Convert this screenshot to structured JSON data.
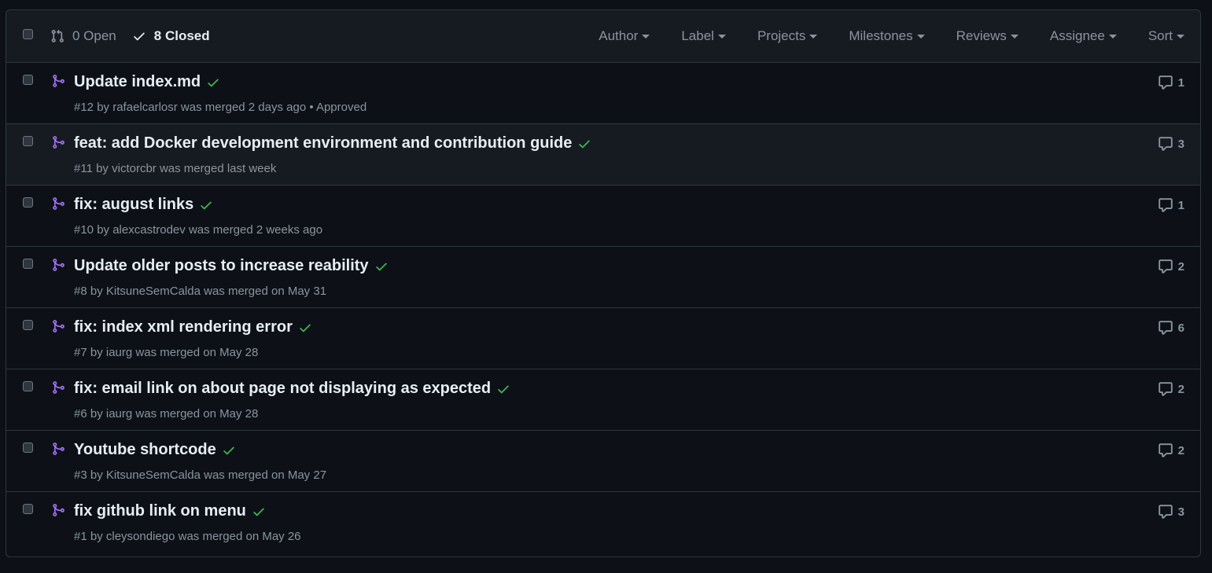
{
  "header": {
    "open_label": "0 Open",
    "closed_label": "8 Closed",
    "filters": [
      "Author",
      "Label",
      "Projects",
      "Milestones",
      "Reviews",
      "Assignee",
      "Sort"
    ]
  },
  "colors": {
    "merged_icon": "#a371f7",
    "check": "#3fb950",
    "text_primary": "#e6edf3",
    "text_muted": "#8b949e"
  },
  "pulls": [
    {
      "title": "Update index.md",
      "number": "#12",
      "by": "by",
      "author": "rafaelcarlosr",
      "merged": "was merged 2 days ago",
      "extra": " • Approved",
      "comments": "1"
    },
    {
      "title": "feat: add Docker development environment and contribution guide",
      "number": "#11",
      "by": "by",
      "author": "victorcbr",
      "merged": "was merged last week",
      "extra": "",
      "comments": "3"
    },
    {
      "title": "fix: august links",
      "number": "#10",
      "by": "by",
      "author": "alexcastrodev",
      "merged": "was merged 2 weeks ago",
      "extra": "",
      "comments": "1"
    },
    {
      "title": "Update older posts to increase reability",
      "number": "#8",
      "by": "by",
      "author": "KitsuneSemCalda",
      "merged": "was merged on May 31",
      "extra": "",
      "comments": "2"
    },
    {
      "title": "fix: index xml rendering error",
      "number": "#7",
      "by": "by",
      "author": "iaurg",
      "merged": "was merged on May 28",
      "extra": "",
      "comments": "6"
    },
    {
      "title": "fix: email link on about page not displaying as expected",
      "number": "#6",
      "by": "by",
      "author": "iaurg",
      "merged": "was merged on May 28",
      "extra": "",
      "comments": "2"
    },
    {
      "title": "Youtube shortcode",
      "number": "#3",
      "by": "by",
      "author": "KitsuneSemCalda",
      "merged": "was merged on May 27",
      "extra": "",
      "comments": "2"
    },
    {
      "title": "fix github link on menu",
      "number": "#1",
      "by": "by",
      "author": "cleysondiego",
      "merged": "was merged on May 26",
      "extra": "",
      "comments": "3"
    }
  ]
}
